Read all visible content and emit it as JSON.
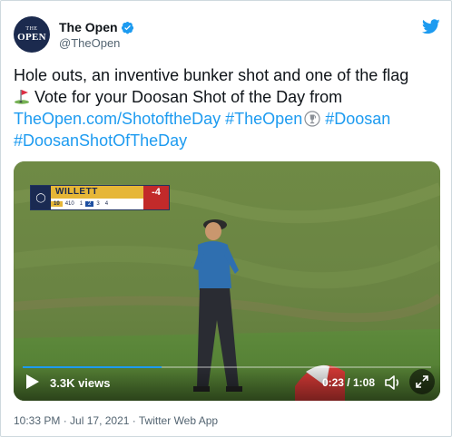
{
  "account": {
    "display_name": "The Open",
    "handle": "@TheOpen",
    "avatar_top": "THE",
    "avatar_bottom": "OPEN"
  },
  "tweet": {
    "text_line_1": "Hole outs, an inventive bunker shot and one of the flag",
    "text_line_2_suffix": " Vote for your Doosan Shot of the Day from",
    "link_url": "TheOpen.com/ShotoftheDay",
    "hashtag_1": "#TheOpen",
    "hashtag_2": "#Doosan",
    "hashtag_3": "#DoosanShotOfTheDay"
  },
  "video": {
    "views": "3.3K views",
    "time": "0:23 / 1:08",
    "progress_fraction": 0.34,
    "scorebug": {
      "player": "WILLETT",
      "score": "-4",
      "hole": "10",
      "yards": "410",
      "cells": [
        "1",
        "2",
        "3",
        "4"
      ]
    }
  },
  "meta": {
    "time": "10:33 PM",
    "date": "Jul 17, 2021",
    "source": "Twitter Web App",
    "separator": " · "
  },
  "colors": {
    "link": "#1d9bf0",
    "verified": "#1d9bf0",
    "avatar_bg": "#1b2a4e",
    "scorebug_gold": "#e6b637",
    "scorebug_red": "#c22a2a"
  },
  "icons": [
    "verified-badge-icon",
    "twitter-bird-icon",
    "golf-flag-emoji",
    "claret-jug-emoji",
    "play-icon",
    "volume-icon",
    "fullscreen-icon"
  ]
}
